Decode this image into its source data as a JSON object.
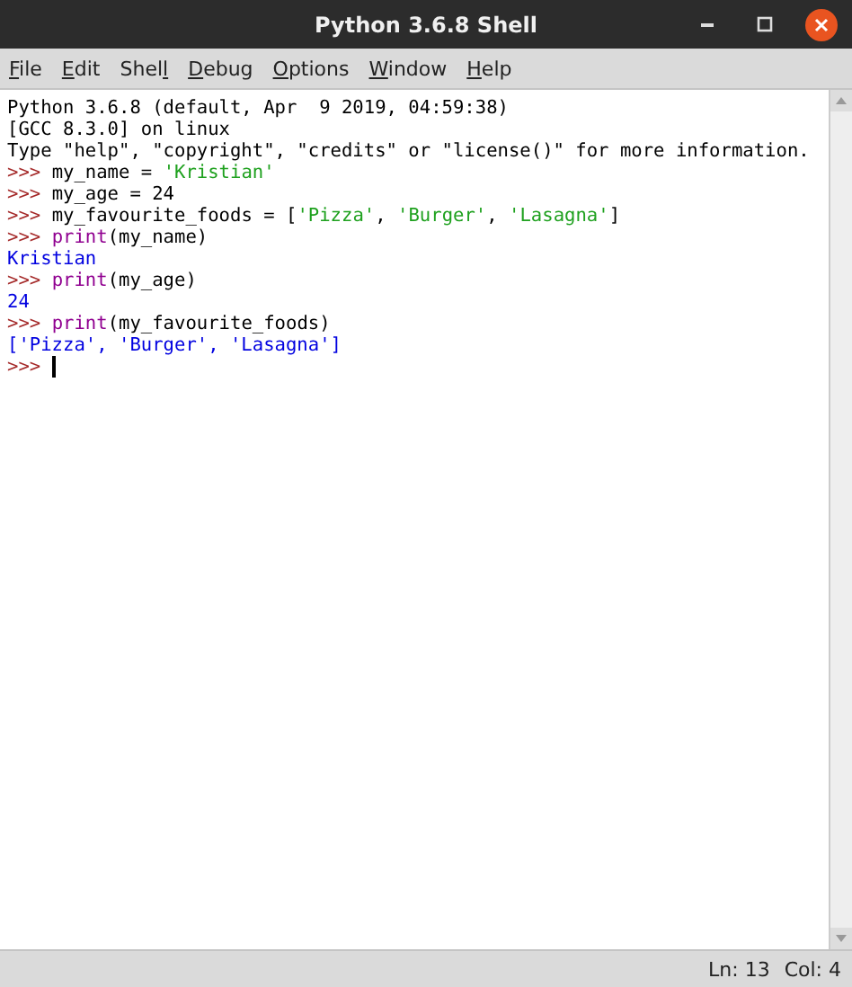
{
  "window": {
    "title": "Python 3.6.8 Shell"
  },
  "menu": [
    {
      "key": "F",
      "rest": "ile"
    },
    {
      "key": "E",
      "rest": "dit"
    },
    {
      "lead": "Shel",
      "key": "l"
    },
    {
      "key": "D",
      "rest": "ebug"
    },
    {
      "key": "O",
      "rest": "ptions"
    },
    {
      "key": "W",
      "rest": "indow"
    },
    {
      "key": "H",
      "rest": "elp"
    }
  ],
  "shell_lines": [
    [
      {
        "kind": "plain",
        "text": "Python 3.6.8 (default, Apr  9 2019, 04:59:38)"
      }
    ],
    [
      {
        "kind": "plain",
        "text": "[GCC 8.3.0] on linux"
      }
    ],
    [
      {
        "kind": "plain",
        "text": "Type \"help\", \"copyright\", \"credits\" or \"license()\" for more information."
      }
    ],
    [
      {
        "kind": "prompt",
        "text": ">>> "
      },
      {
        "kind": "plain",
        "text": "my_name = "
      },
      {
        "kind": "string",
        "text": "'Kristian'"
      }
    ],
    [
      {
        "kind": "prompt",
        "text": ">>> "
      },
      {
        "kind": "plain",
        "text": "my_age = 24"
      }
    ],
    [
      {
        "kind": "prompt",
        "text": ">>> "
      },
      {
        "kind": "plain",
        "text": "my_favourite_foods = ["
      },
      {
        "kind": "string",
        "text": "'Pizza'"
      },
      {
        "kind": "plain",
        "text": ", "
      },
      {
        "kind": "string",
        "text": "'Burger'"
      },
      {
        "kind": "plain",
        "text": ", "
      },
      {
        "kind": "string",
        "text": "'Lasagna'"
      },
      {
        "kind": "plain",
        "text": "]"
      }
    ],
    [
      {
        "kind": "prompt",
        "text": ">>> "
      },
      {
        "kind": "builtin",
        "text": "print"
      },
      {
        "kind": "plain",
        "text": "(my_name)"
      }
    ],
    [
      {
        "kind": "output",
        "text": "Kristian"
      }
    ],
    [
      {
        "kind": "prompt",
        "text": ">>> "
      },
      {
        "kind": "builtin",
        "text": "print"
      },
      {
        "kind": "plain",
        "text": "(my_age)"
      }
    ],
    [
      {
        "kind": "output",
        "text": "24"
      }
    ],
    [
      {
        "kind": "prompt",
        "text": ">>> "
      },
      {
        "kind": "builtin",
        "text": "print"
      },
      {
        "kind": "plain",
        "text": "(my_favourite_foods)"
      }
    ],
    [
      {
        "kind": "output",
        "text": "['Pizza', 'Burger', 'Lasagna']"
      }
    ],
    [
      {
        "kind": "prompt",
        "text": ">>> "
      }
    ]
  ],
  "status_bar": {
    "line": "Ln: 13",
    "col": "Col: 4"
  }
}
